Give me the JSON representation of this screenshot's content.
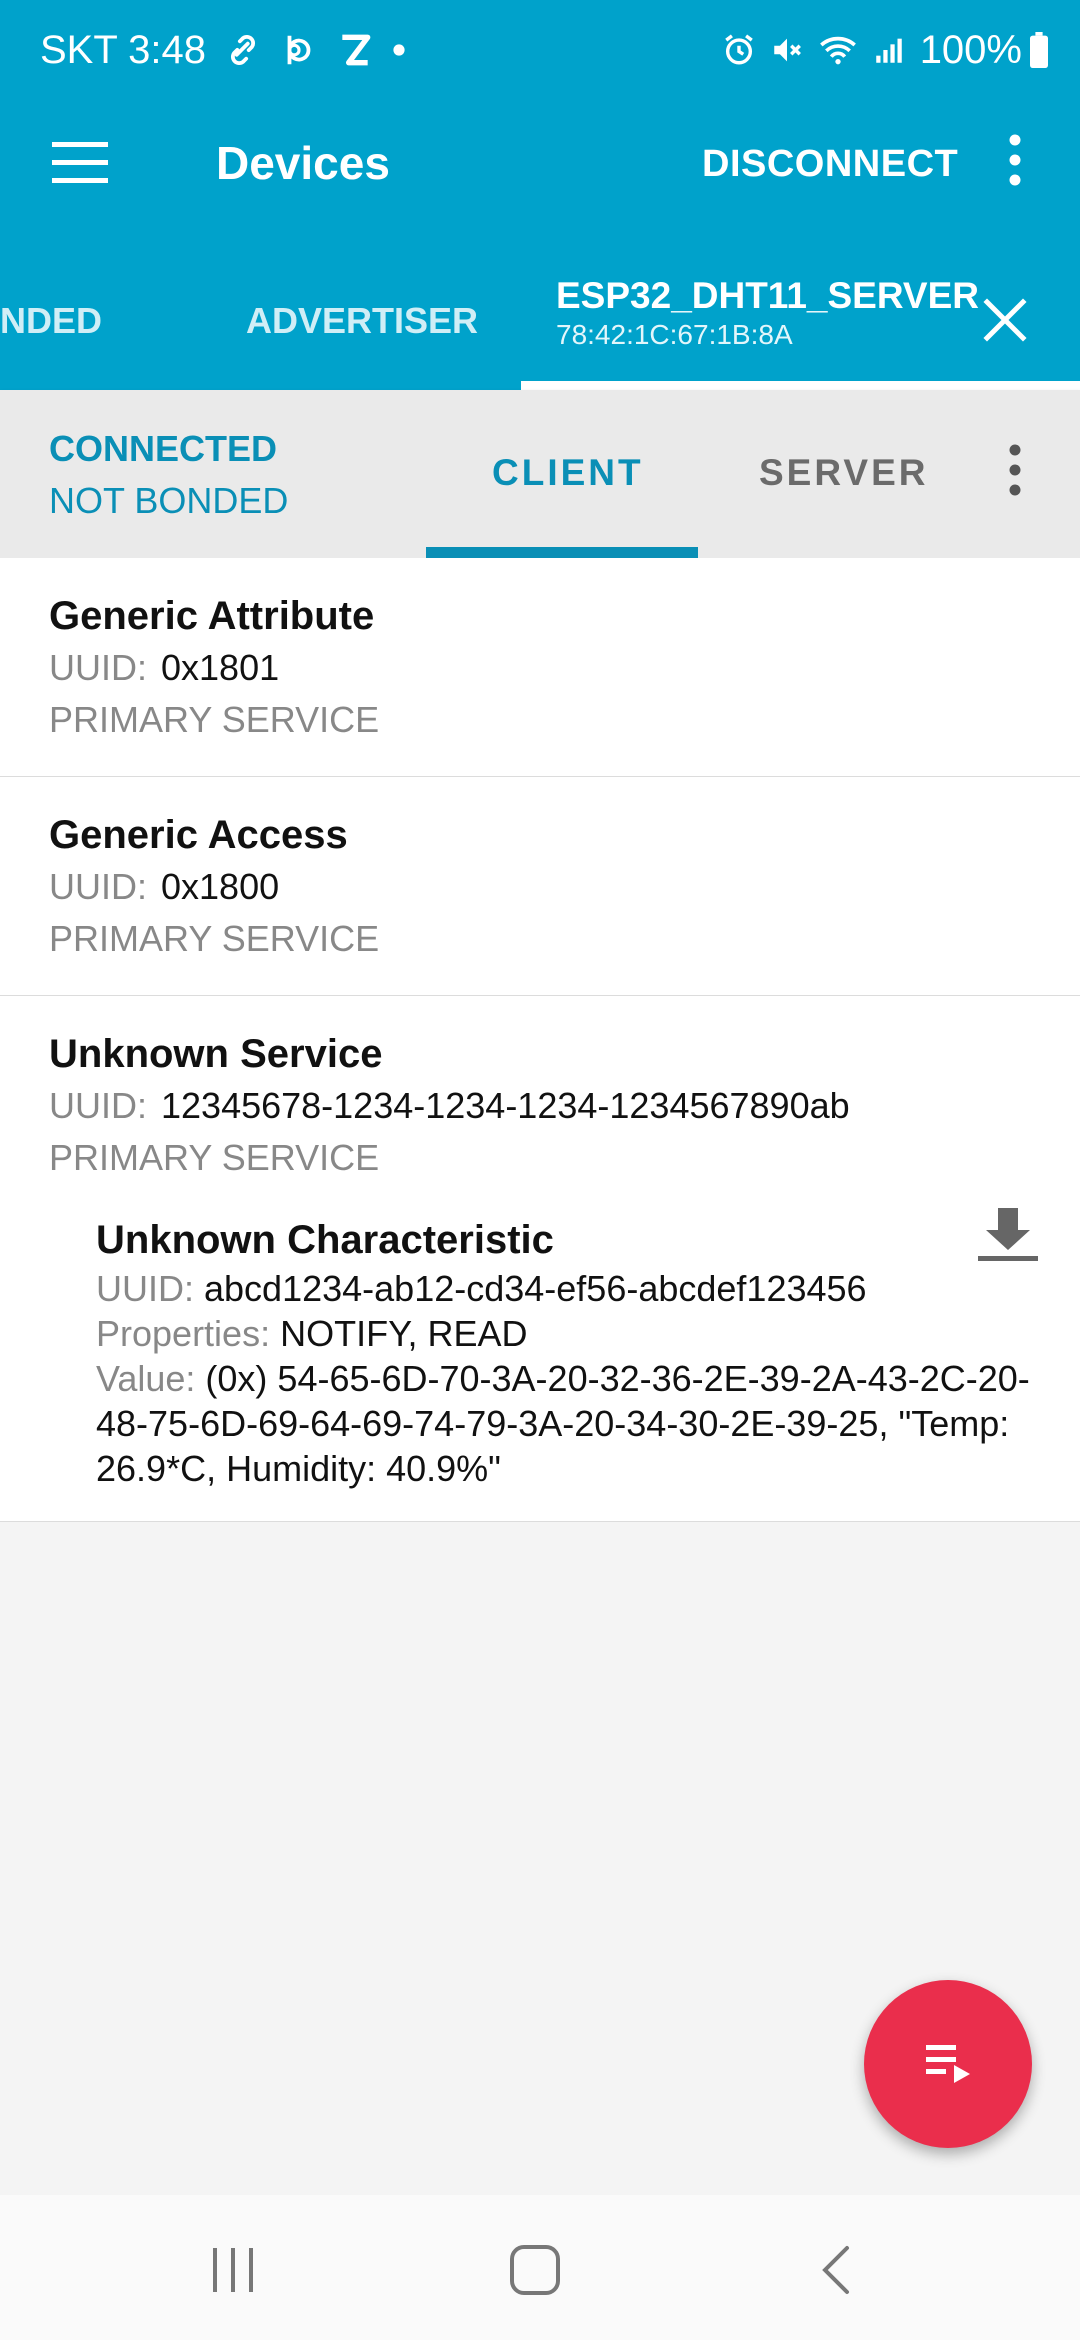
{
  "status_bar": {
    "carrier_time": "SKT 3:48",
    "battery": "100%"
  },
  "toolbar": {
    "title": "Devices",
    "disconnect_label": "DISCONNECT"
  },
  "device_tabs": {
    "bonded_partial": "NDED",
    "advertiser": "ADVERTISER",
    "device_name": "ESP32_DHT11_SERVER",
    "device_mac": "78:42:1C:67:1B:8A"
  },
  "connection": {
    "state": "CONNECTED",
    "bond": "NOT BONDED",
    "tabs": [
      "CLIENT",
      "SERVER"
    ],
    "active_tab": "CLIENT"
  },
  "services": [
    {
      "name": "Generic Attribute",
      "uuid_label": "UUID:",
      "uuid": "0x1801",
      "type": "PRIMARY SERVICE"
    },
    {
      "name": "Generic Access",
      "uuid_label": "UUID:",
      "uuid": "0x1800",
      "type": "PRIMARY SERVICE"
    },
    {
      "name": "Unknown Service",
      "uuid_label": "UUID:",
      "uuid": "12345678-1234-1234-1234-1234567890ab",
      "type": "PRIMARY SERVICE",
      "characteristic": {
        "name": "Unknown Characteristic",
        "uuid_label": "UUID:",
        "uuid": "abcd1234-ab12-cd34-ef56-abcdef123456",
        "properties_label": "Properties:",
        "properties": "NOTIFY, READ",
        "value_label": "Value:",
        "value": "(0x) 54-65-6D-70-3A-20-32-36-2E-39-2A-43-2C-20-48-75-6D-69-64-69-74-79-3A-20-34-30-2E-39-25, \"Temp: 26.9*C, Humidity: 40.9%\""
      }
    }
  ],
  "icons": {
    "menu": "hamburger-icon",
    "overflow": "more-vert-icon",
    "close": "close-icon",
    "download": "download-icon",
    "fab": "playlist-play-icon",
    "nav_recents": "recents-icon",
    "nav_home": "home-icon",
    "nav_back": "back-icon"
  },
  "colors": {
    "app_bar": "#00a2cb",
    "accent": "#0a8fb6",
    "fab": "#ea2e4c"
  }
}
